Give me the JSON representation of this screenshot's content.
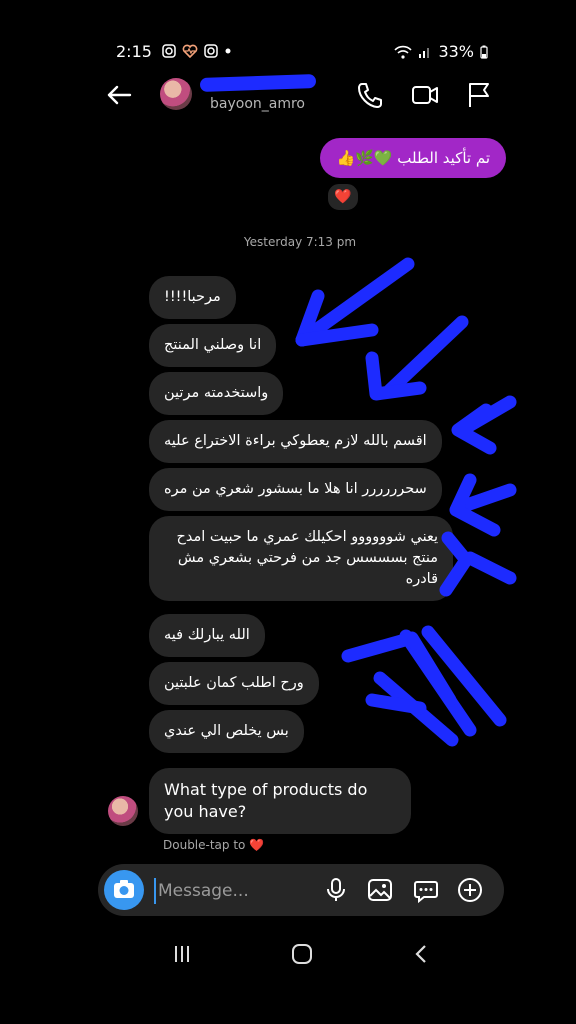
{
  "status": {
    "time": "2:15",
    "battery": "33%",
    "notification_icons": [
      "instagram-icon",
      "heart-pulse-icon",
      "instagram-icon",
      "dot-icon"
    ]
  },
  "header": {
    "username": "bayoon_amro",
    "icons": [
      "back-arrow-icon",
      "phone-icon",
      "video-icon",
      "flag-icon"
    ]
  },
  "conversation": {
    "sent_message": "تم تأكيد الطلب 💚🌿👍",
    "sent_reaction": "❤️",
    "timestamp": "Yesterday 7:13 pm",
    "received": [
      "مرحبا!!!!",
      "انا وصلني المنتج",
      "واستخدمته مرتين",
      "اقسم بالله لازم يعطوكي براءة الاختراع عليه",
      "سحرررررر انا هلا ما بسشور شعري من مره",
      "يعني شوووووو احكيلك عمري ما حبيت امدح منتج بسسسس جد من فرحتي بشعري مش قادره",
      "الله يبارلك فيه",
      "ورح اطلب كمان علبتين",
      "بس يخلص الي عندي",
      "What type of products do you have?"
    ],
    "double_tap_hint": "Double-tap to ❤️"
  },
  "composer": {
    "placeholder": "Message...",
    "icons": [
      "camera-icon",
      "microphone-icon",
      "gallery-icon",
      "sticker-icon",
      "plus-icon"
    ]
  },
  "colors": {
    "sent_bubble": "#a227c7",
    "received_bubble": "#262626",
    "camera_button": "#3897f0",
    "annotation": "#1d2bff"
  }
}
